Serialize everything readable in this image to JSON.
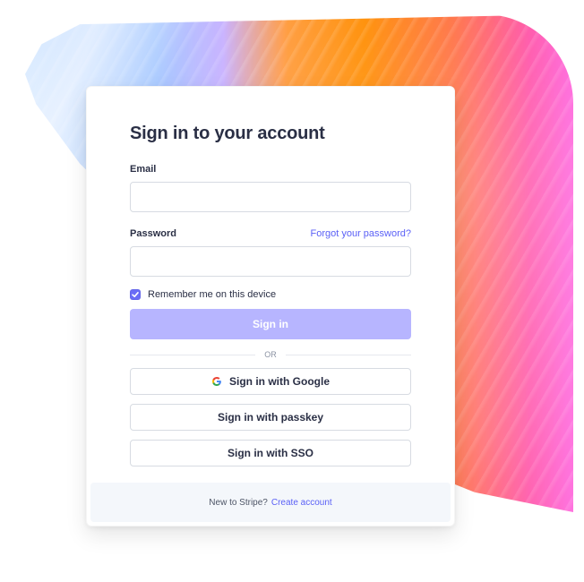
{
  "page": {
    "title": "Sign in to your account"
  },
  "form": {
    "email_label": "Email",
    "email_value": "",
    "password_label": "Password",
    "password_value": "",
    "forgot_link": "Forgot your password?",
    "remember_label": "Remember me on this device",
    "remember_checked": true,
    "signin_button": "Sign in",
    "divider_text": "OR",
    "google_button": "Sign in with Google",
    "passkey_button": "Sign in with passkey",
    "sso_button": "Sign in with SSO"
  },
  "footer": {
    "prompt": "New to Stripe?",
    "link": "Create account"
  },
  "icons": {
    "google": "google-icon",
    "checkbox": "checkmark-icon"
  },
  "colors": {
    "accent": "#5b61f6",
    "primary_button_bg": "#b7b5ff",
    "checkbox_bg": "#6a6cf6"
  }
}
